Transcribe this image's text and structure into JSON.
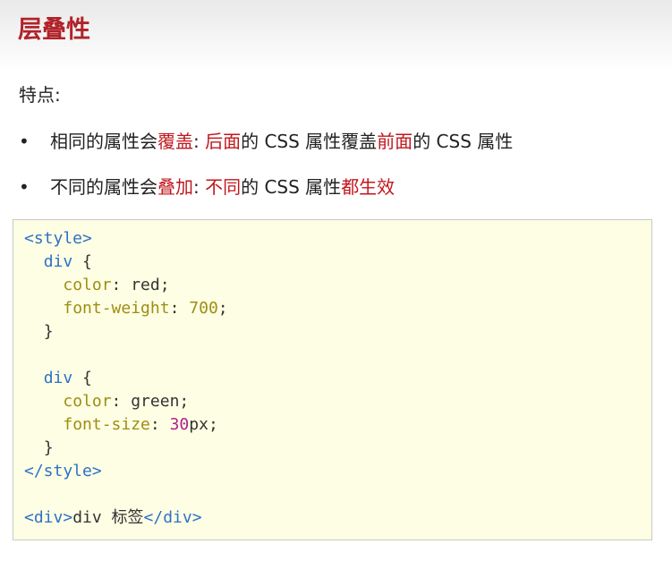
{
  "slide": {
    "title": "层叠性",
    "subhead": "特点:",
    "bullets": [
      {
        "marker": "•",
        "parts": [
          "相同的属性会",
          "覆盖",
          ": ",
          "后面",
          "的 CSS 属性覆盖",
          "前面",
          "的 CSS 属性"
        ]
      },
      {
        "marker": "•",
        "parts": [
          "不同的属性会",
          "叠加",
          ": ",
          "不同",
          "的 CSS 属性",
          "都生效"
        ]
      }
    ]
  },
  "code": {
    "open_style": "<style>",
    "sel1": "div",
    "brace_open": " {",
    "p1_name": "color",
    "p1_value": ": red;",
    "p2_name": "font-weight",
    "p2_sep": ": ",
    "p2_value": "700",
    "semi": ";",
    "brace_close": "}",
    "sel2": "div",
    "p3_name": "color",
    "p3_value": ": green;",
    "p4_name": "font-size",
    "p4_sep": ": ",
    "p4_num": "30",
    "p4_unit": "px;",
    "close_style": "</style>",
    "div_open": "<div>",
    "div_text": "div 标签",
    "div_close": "</div>"
  }
}
